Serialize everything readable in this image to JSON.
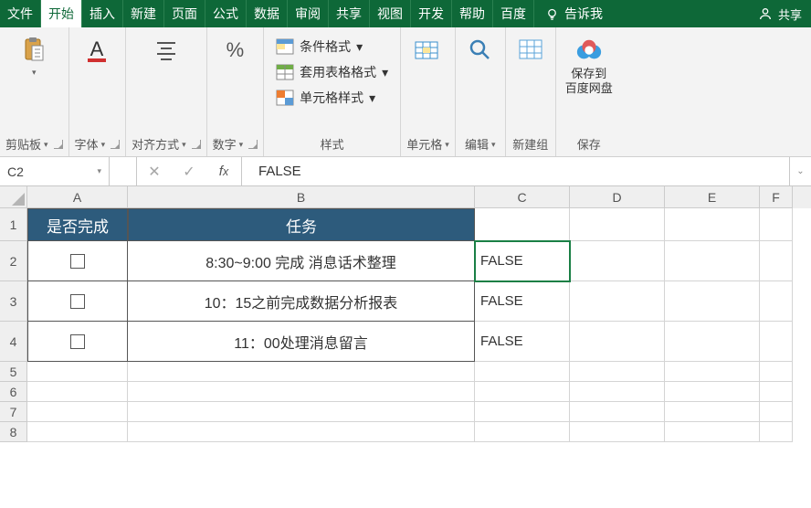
{
  "menu": {
    "tabs": [
      "文件",
      "开始",
      "插入",
      "新建",
      "页面",
      "公式",
      "数据",
      "审阅",
      "共享",
      "视图",
      "开发",
      "帮助",
      "百度"
    ],
    "active": 1,
    "tell": "告诉我",
    "share": "共享"
  },
  "ribbon": {
    "clipboard": {
      "label": "剪贴板"
    },
    "font": {
      "label": "字体"
    },
    "align": {
      "label": "对齐方式"
    },
    "number": {
      "label": "数字"
    },
    "styles": {
      "label": "样式",
      "cond": "条件格式",
      "table": "套用表格格式",
      "cell": "单元格样式"
    },
    "cells": {
      "label": "单元格"
    },
    "editing": {
      "label": "编辑"
    },
    "newgroup": {
      "label": "新建组"
    },
    "save": {
      "btn": "保存到\n百度网盘",
      "label": "保存"
    }
  },
  "formula_bar": {
    "name": "C2",
    "value": "FALSE"
  },
  "sheet": {
    "cols": [
      "A",
      "B",
      "C",
      "D",
      "E",
      "F"
    ],
    "header": {
      "a": "是否完成",
      "b": "任务"
    },
    "rows": [
      {
        "b": "8:30~9:00 完成 消息话术整理",
        "c": "FALSE"
      },
      {
        "b": "10：15之前完成数据分析报表",
        "c": "FALSE"
      },
      {
        "b": "11：00处理消息留言",
        "c": "FALSE"
      }
    ],
    "row_numbers": [
      "1",
      "2",
      "3",
      "4",
      "5",
      "6",
      "7",
      "8"
    ]
  }
}
